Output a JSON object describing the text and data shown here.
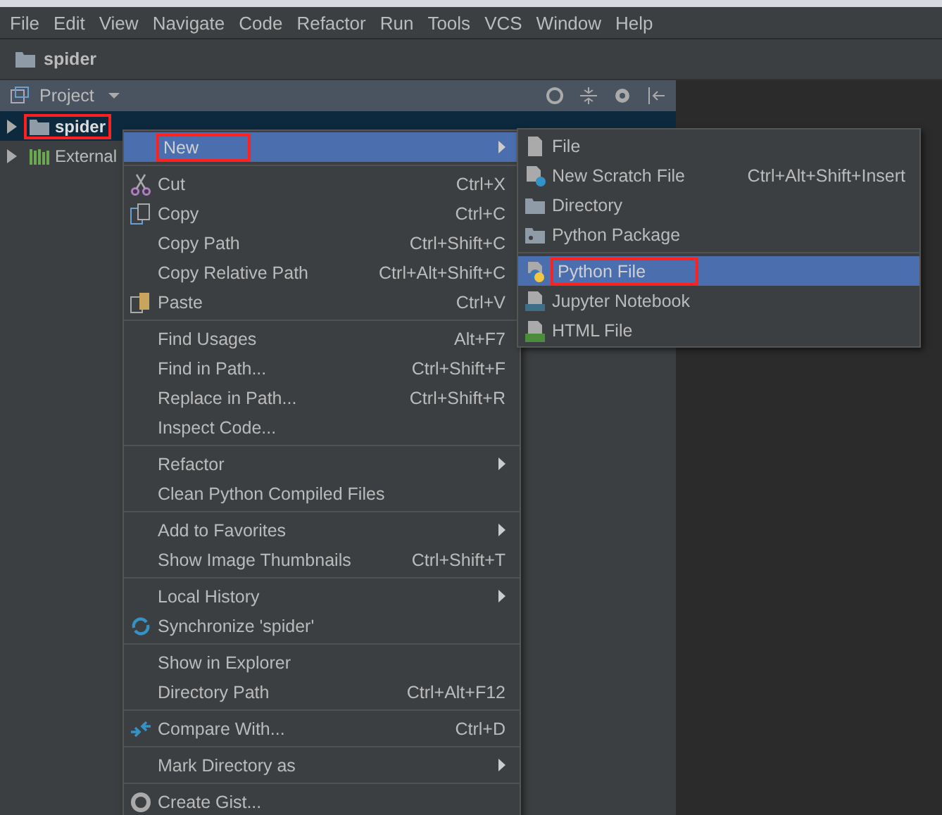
{
  "menu_bar": [
    "File",
    "Edit",
    "View",
    "Navigate",
    "Code",
    "Refactor",
    "Run",
    "Tools",
    "VCS",
    "Window",
    "Help"
  ],
  "breadcrumb": "spider",
  "project_panel": {
    "title": "Project",
    "tree": [
      {
        "label": "spider",
        "expanded": false,
        "highlighted": true,
        "selected": true
      },
      {
        "label": "External",
        "expanded": false,
        "highlighted": false,
        "selected": false
      }
    ]
  },
  "context_menu": [
    {
      "kind": "item",
      "label": "New",
      "submenu": true,
      "selected": true,
      "highlighted": true
    },
    {
      "kind": "separator"
    },
    {
      "kind": "item",
      "label": "Cut",
      "shortcut": "Ctrl+X"
    },
    {
      "kind": "item",
      "label": "Copy",
      "shortcut": "Ctrl+C"
    },
    {
      "kind": "item",
      "label": "Copy Path",
      "shortcut": "Ctrl+Shift+C"
    },
    {
      "kind": "item",
      "label": "Copy Relative Path",
      "shortcut": "Ctrl+Alt+Shift+C"
    },
    {
      "kind": "item",
      "label": "Paste",
      "shortcut": "Ctrl+V"
    },
    {
      "kind": "separator"
    },
    {
      "kind": "item",
      "label": "Find Usages",
      "shortcut": "Alt+F7"
    },
    {
      "kind": "item",
      "label": "Find in Path...",
      "shortcut": "Ctrl+Shift+F"
    },
    {
      "kind": "item",
      "label": "Replace in Path...",
      "shortcut": "Ctrl+Shift+R"
    },
    {
      "kind": "item",
      "label": "Inspect Code..."
    },
    {
      "kind": "separator"
    },
    {
      "kind": "item",
      "label": "Refactor",
      "submenu": true
    },
    {
      "kind": "item",
      "label": "Clean Python Compiled Files"
    },
    {
      "kind": "separator"
    },
    {
      "kind": "item",
      "label": "Add to Favorites",
      "submenu": true
    },
    {
      "kind": "item",
      "label": "Show Image Thumbnails",
      "shortcut": "Ctrl+Shift+T"
    },
    {
      "kind": "separator"
    },
    {
      "kind": "item",
      "label": "Local History",
      "submenu": true
    },
    {
      "kind": "item",
      "label": "Synchronize 'spider'"
    },
    {
      "kind": "separator"
    },
    {
      "kind": "item",
      "label": "Show in Explorer"
    },
    {
      "kind": "item",
      "label": "Directory Path",
      "shortcut": "Ctrl+Alt+F12"
    },
    {
      "kind": "separator"
    },
    {
      "kind": "item",
      "label": "Compare With...",
      "shortcut": "Ctrl+D"
    },
    {
      "kind": "separator"
    },
    {
      "kind": "item",
      "label": "Mark Directory as",
      "submenu": true
    },
    {
      "kind": "separator"
    },
    {
      "kind": "item",
      "label": "Create Gist..."
    }
  ],
  "new_submenu": [
    {
      "kind": "item",
      "label": "File",
      "selected": false,
      "highlighted": false
    },
    {
      "kind": "item",
      "label": "New Scratch File",
      "shortcut": "Ctrl+Alt+Shift+Insert",
      "selected": false,
      "highlighted": false
    },
    {
      "kind": "item",
      "label": "Directory",
      "selected": false,
      "highlighted": false
    },
    {
      "kind": "item",
      "label": "Python Package",
      "selected": false,
      "highlighted": false
    },
    {
      "kind": "separator"
    },
    {
      "kind": "item",
      "label": "Python File",
      "selected": true,
      "highlighted": true
    },
    {
      "kind": "item",
      "label": "Jupyter Notebook",
      "selected": false,
      "highlighted": false
    },
    {
      "kind": "item",
      "label": "HTML File",
      "selected": false,
      "highlighted": false
    }
  ]
}
